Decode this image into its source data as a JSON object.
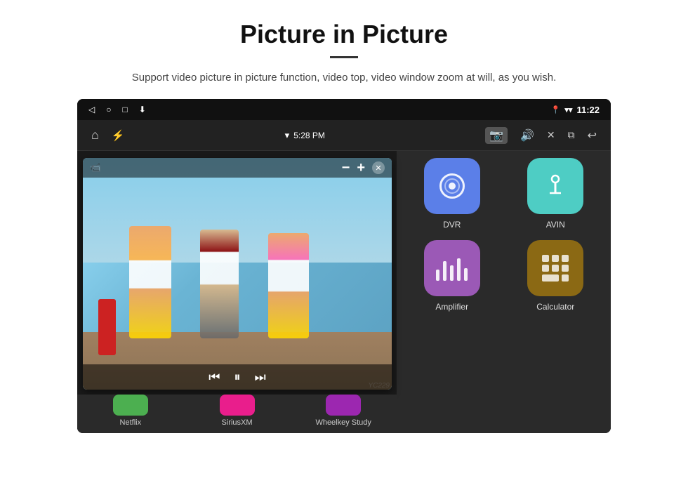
{
  "header": {
    "title": "Picture in Picture",
    "description": "Support video picture in picture function, video top, video window zoom at will, as you wish."
  },
  "statusBar": {
    "time": "11:22",
    "navBack": "◁",
    "navHome": "○",
    "navRecents": "□",
    "navDownload": "⬇"
  },
  "navBar": {
    "homeIcon": "⌂",
    "usbIcon": "⚡",
    "wifiSignal": "▾",
    "time": "5:28 PM",
    "cameraIcon": "📷",
    "volumeIcon": "🔊",
    "closeIcon": "✕",
    "pipIcon": "⧉",
    "backIcon": "↩"
  },
  "pipWindow": {
    "minus": "−",
    "plus": "+",
    "closeBtn": "✕",
    "prevBtn": "⏮",
    "playBtn": "⏸",
    "nextBtn": "⏭"
  },
  "apps": [
    {
      "id": "dvr",
      "label": "DVR",
      "iconClass": "icon-dvr",
      "iconType": "dvr"
    },
    {
      "id": "avin",
      "label": "AVIN",
      "iconClass": "icon-avin",
      "iconType": "avin"
    },
    {
      "id": "amplifier",
      "label": "Amplifier",
      "iconClass": "icon-amplifier",
      "iconType": "amplifier"
    },
    {
      "id": "calculator",
      "label": "Calculator",
      "iconClass": "icon-calculator",
      "iconType": "calculator"
    }
  ],
  "bottomApps": [
    {
      "label": "Netflix"
    },
    {
      "label": "SiriusXM"
    },
    {
      "label": "Wheelkey Study"
    },
    {
      "label": "Amplifier"
    },
    {
      "label": "Calculator"
    }
  ],
  "watermark": "YC229"
}
